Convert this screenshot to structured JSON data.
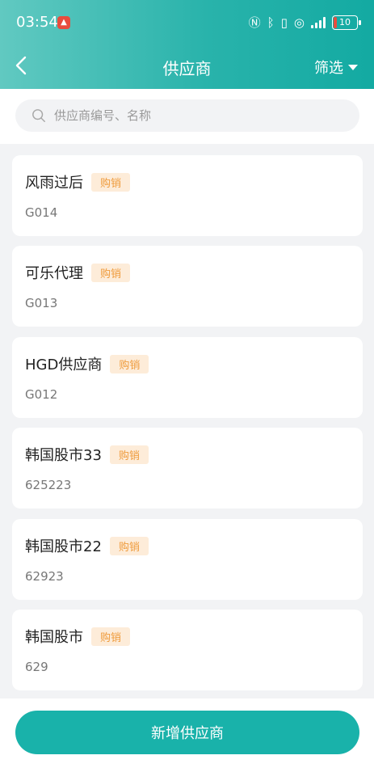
{
  "status_bar": {
    "time": "03:54",
    "battery": "10"
  },
  "header": {
    "title": "供应商",
    "filter_label": "筛选"
  },
  "search": {
    "placeholder": "供应商编号、名称"
  },
  "suppliers": [
    {
      "name": "风雨过后",
      "tag": "购销",
      "code": "G014"
    },
    {
      "name": "可乐代理",
      "tag": "购销",
      "code": "G013"
    },
    {
      "name": "HGD供应商",
      "tag": "购销",
      "code": "G012"
    },
    {
      "name": "韩国股市33",
      "tag": "购销",
      "code": "625223"
    },
    {
      "name": "韩国股市22",
      "tag": "购销",
      "code": "62923"
    },
    {
      "name": "韩国股市",
      "tag": "购销",
      "code": "629"
    }
  ],
  "footer": {
    "add_button": "新增供应商"
  },
  "colors": {
    "accent": "#19b2aa",
    "tag_bg": "#fdecd9",
    "tag_text": "#ef9b3c"
  }
}
